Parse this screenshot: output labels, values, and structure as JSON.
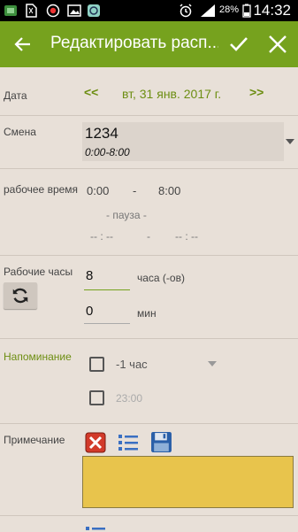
{
  "status": {
    "battery": "28%",
    "clock": "14:32"
  },
  "appbar": {
    "title": "Редактировать расп..."
  },
  "date": {
    "label": "Дата",
    "prev": "<<",
    "value": "вт, 31 янв. 2017 г.",
    "next": ">>"
  },
  "shift": {
    "label": "Смена",
    "name": "1234",
    "time": "0:00-8:00"
  },
  "worktime": {
    "label": "рабочее время",
    "start": "0:00",
    "dash": "-",
    "end": "8:00",
    "pause_label": "- пауза -",
    "pause_start": "-- : --",
    "pause_dash": "-",
    "pause_end": "-- : --"
  },
  "hours": {
    "label": "Рабочие часы",
    "hours_value": "8",
    "hours_unit": "часа (-ов)",
    "min_value": "0",
    "min_unit": "мин"
  },
  "reminder": {
    "label": "Напоминание",
    "option1": "-1 час",
    "option2": "23:00"
  },
  "note": {
    "label": "Примечание",
    "text": ""
  },
  "colors": {
    "accent": "#76a21e",
    "note_bg": "#e8c44c",
    "bg": "#e8e0d8"
  }
}
